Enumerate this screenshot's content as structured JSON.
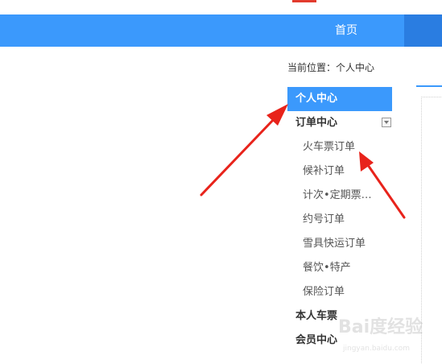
{
  "nav": {
    "home_label": "首页"
  },
  "breadcrumb": {
    "text": "当前位置：个人中心"
  },
  "sidebar": {
    "active_item": "个人中心",
    "order_center": {
      "label": "订单中心",
      "items": [
        "火车票订单",
        "候补订单",
        "计次•定期票…",
        "约号订单",
        "雪具快运订单",
        "餐饮•特产",
        "保险订单"
      ]
    },
    "my_tickets": "本人车票",
    "member_center": "会员中心"
  },
  "watermark": {
    "text": "Bai度经验",
    "sub": "jingyan.baidu.com"
  },
  "colors": {
    "nav_blue": "#3b99fc",
    "nav_dark_blue": "#2a7de1",
    "annotation_red": "#e8231b"
  }
}
